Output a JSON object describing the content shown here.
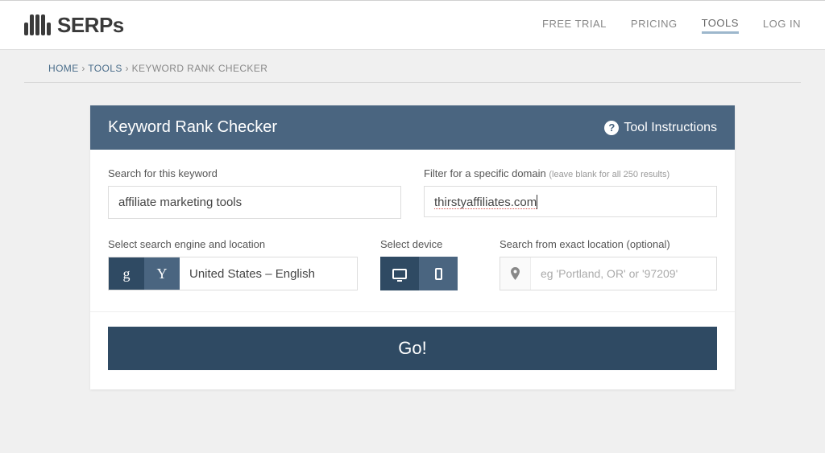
{
  "brand": {
    "name": "SERPs"
  },
  "nav": {
    "free_trial": "FREE TRIAL",
    "pricing": "PRICING",
    "tools": "TOOLS",
    "login": "LOG IN"
  },
  "breadcrumb": {
    "home": "HOME",
    "tools": "TOOLS",
    "current": "KEYWORD RANK CHECKER"
  },
  "panel": {
    "title": "Keyword Rank Checker",
    "instructions": "Tool Instructions"
  },
  "form": {
    "keyword_label": "Search for this keyword",
    "keyword_value": "affiliate marketing tools",
    "domain_label": "Filter for a specific domain ",
    "domain_hint": "(leave blank for all 250 results)",
    "domain_value": "thirstyaffiliates.com",
    "engine_label": "Select search engine and location",
    "engine_google": "g",
    "engine_yahoo": "Y",
    "engine_location": "United States – English",
    "device_label": "Select device",
    "location_label": "Search from exact location (optional)",
    "location_placeholder": "eg 'Portland, OR' or '97209'",
    "submit": "Go!"
  }
}
